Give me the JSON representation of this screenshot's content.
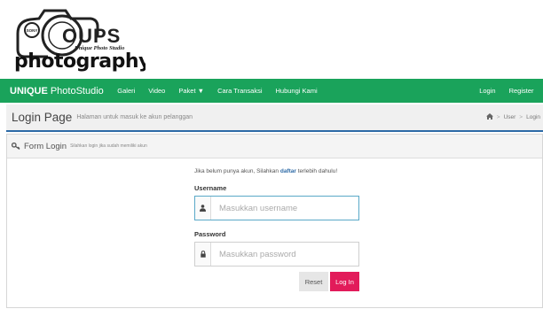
{
  "logo": {
    "camera_text": "OUPS",
    "tagline": "Unique Photo Studio",
    "wordmark": "photography",
    "lens_text": "SONY"
  },
  "navbar": {
    "brand_bold": "UNIQUE",
    "brand_rest": " PhotoStudio",
    "items": [
      "Galeri",
      "Video",
      "Paket",
      "Cara Transaksi",
      "Hubungi Kami"
    ],
    "right_items": [
      "Login",
      "Register"
    ],
    "color": "#1aa35b"
  },
  "page_header": {
    "title": "Login Page",
    "subtitle": "Halaman untuk masuk ke akun pelanggan",
    "breadcrumb": [
      "User",
      "Login"
    ]
  },
  "form": {
    "box_title": "Form Login",
    "box_subtitle": "Silahkan login jika sudah memiliki akun",
    "info_prefix": "Jika belum punya akun, Silahkan ",
    "info_link": "daftar",
    "info_suffix": " terlebih dahulu!",
    "username_label": "Username",
    "username_placeholder": "Masukkan username",
    "password_label": "Password",
    "password_placeholder": "Masukkan password",
    "reset_label": "Reset",
    "login_label": "Log In",
    "login_color": "#e21b5a"
  }
}
